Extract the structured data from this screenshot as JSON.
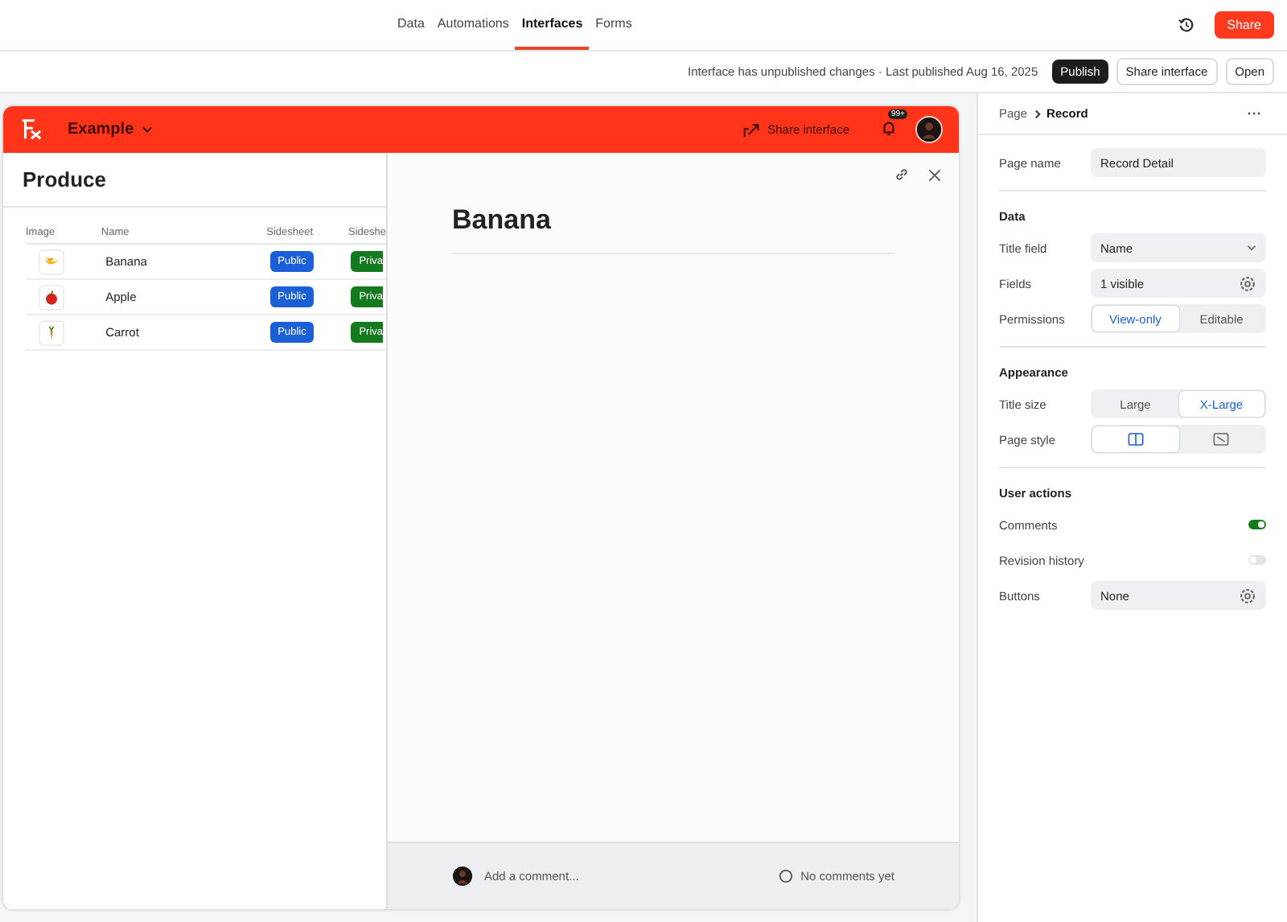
{
  "nav": {
    "tabs": [
      {
        "label": "Data",
        "selected": false
      },
      {
        "label": "Automations",
        "selected": false
      },
      {
        "label": "Interfaces",
        "selected": true
      },
      {
        "label": "Forms",
        "selected": false
      }
    ],
    "share": "Share"
  },
  "subbar": {
    "status": "Interface has unpublished changes · Last published Aug 16, 2025",
    "buttons": [
      {
        "label": "Publish",
        "kind": "primary"
      },
      {
        "label": "Share interface",
        "kind": "outline"
      },
      {
        "label": "Open",
        "kind": "outline"
      }
    ]
  },
  "app": {
    "name": "Example",
    "share": "Share interface",
    "notifications": "99+"
  },
  "list": {
    "title": "Produce",
    "columns": [
      "Image",
      "Name",
      "Sidesheet",
      "Sideshe"
    ],
    "rows": [
      {
        "kind": "banana",
        "name": "Banana",
        "badges": [
          {
            "text": "Public",
            "color": "#1a5fd6"
          },
          {
            "text": "Priva",
            "color": "#137a1e"
          }
        ]
      },
      {
        "kind": "apple",
        "name": "Apple",
        "badges": [
          {
            "text": "Public",
            "color": "#1a5fd6"
          },
          {
            "text": "Priva",
            "color": "#137a1e"
          }
        ]
      },
      {
        "kind": "carrot",
        "name": "Carrot",
        "badges": [
          {
            "text": "Public",
            "color": "#1a5fd6"
          },
          {
            "text": "Priva",
            "color": "#137a1e"
          }
        ]
      }
    ]
  },
  "sheet": {
    "title": "Banana",
    "comment_placeholder": "Add a comment...",
    "comments": "No comments yet"
  },
  "panel": {
    "breadcrumb": [
      "Page",
      "Record"
    ],
    "sections": [
      {
        "rows": [
          {
            "kind": "input",
            "label": "Page name",
            "value": "Record Detail"
          }
        ]
      },
      {
        "title": "Data",
        "rows": [
          {
            "kind": "select",
            "label": "Title field",
            "value": "Name"
          },
          {
            "kind": "gear",
            "label": "Fields",
            "value": "1 visible"
          },
          {
            "kind": "segmented",
            "label": "Permissions",
            "options": [
              {
                "label": "View-only",
                "selected": true
              },
              {
                "label": "Editable",
                "selected": false
              }
            ]
          }
        ]
      },
      {
        "title": "Appearance",
        "rows": [
          {
            "kind": "segmented",
            "label": "Title size",
            "options": [
              {
                "label": "Large",
                "selected": false
              },
              {
                "label": "X-Large",
                "selected": true
              }
            ]
          },
          {
            "kind": "icons",
            "label": "Page style",
            "options": [
              {
                "kind": "split",
                "selected": true
              },
              {
                "kind": "full",
                "selected": false
              }
            ]
          }
        ]
      },
      {
        "title": "User actions",
        "rows": [
          {
            "kind": "toggle",
            "label": "Comments",
            "on": true
          },
          {
            "kind": "toggle",
            "label": "Revision history",
            "on": false
          },
          {
            "kind": "gear",
            "label": "Buttons",
            "value": "None"
          }
        ]
      }
    ]
  }
}
